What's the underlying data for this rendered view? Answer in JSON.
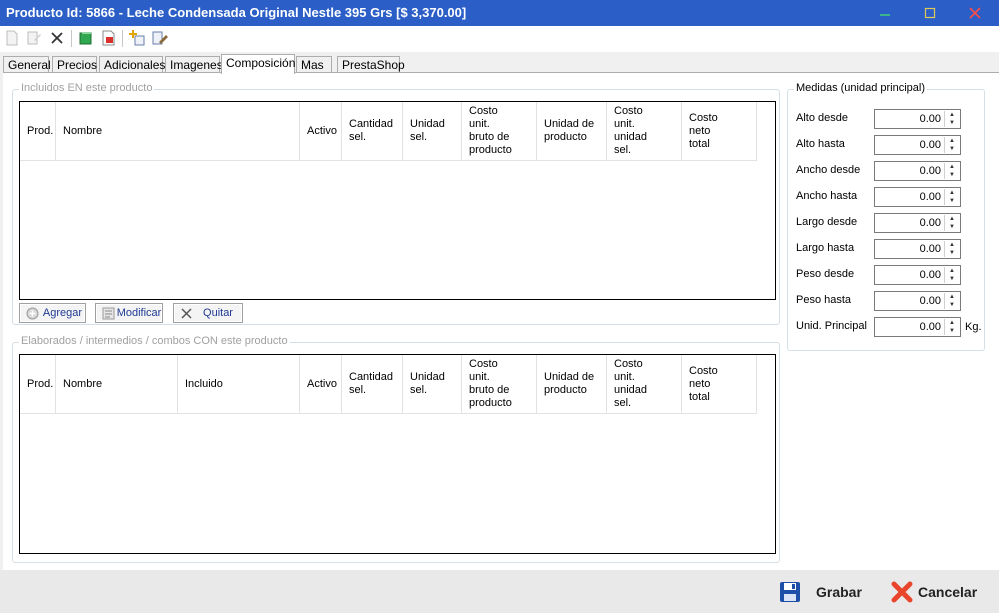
{
  "window": {
    "title": "Producto Id: 5866 - Leche Condensada Original Nestle 395 Grs [$ 3,370.00]",
    "minimize_icon": "minimize-icon",
    "maximize_icon": "maximize-icon",
    "close_icon": "close-icon"
  },
  "toolbar": {
    "icons": [
      "new-document-icon",
      "edit-document-icon",
      "delete-x-icon",
      "green-book-icon",
      "pdf-report-icon",
      "add-item-icon",
      "edit-item-icon"
    ]
  },
  "tabs": [
    {
      "label": "General"
    },
    {
      "label": "Precios"
    },
    {
      "label": "Adicionales"
    },
    {
      "label": "Imagenes"
    },
    {
      "label": "Composición"
    },
    {
      "label": "Mas"
    },
    {
      "label": "PrestaShop"
    }
  ],
  "active_tab": "Composición",
  "incluidos": {
    "title": "Incluidos  EN este producto",
    "columns": [
      "Prod.",
      "Nombre",
      "Activo",
      "Cantidad\nsel.",
      "Unidad\nsel.",
      "Costo\nunit.\nbruto de\nproducto",
      "Unidad de\nproducto",
      "Costo\nunit.\nunidad\nsel.",
      "Costo\nneto\ntotal"
    ],
    "rows": [],
    "buttons": {
      "add": "Agregar",
      "edit": "Modificar",
      "remove": "Quitar"
    }
  },
  "elaborados": {
    "title": "Elaborados / intermedios / combos CON este producto",
    "columns": [
      "Prod.",
      "Nombre",
      "Incluido",
      "Activo",
      "Cantidad\nsel.",
      "Unidad\nsel.",
      "Costo\nunit.\nbruto de\nproducto",
      "Unidad de\nproducto",
      "Costo\nunit.\nunidad\nsel.",
      "Costo\nneto\ntotal"
    ],
    "rows": []
  },
  "medidas": {
    "title": "Medidas (unidad principal)",
    "fields": [
      {
        "label": "Alto desde",
        "value": "0.00"
      },
      {
        "label": "Alto hasta",
        "value": "0.00"
      },
      {
        "label": "Ancho desde",
        "value": "0.00"
      },
      {
        "label": "Ancho hasta",
        "value": "0.00"
      },
      {
        "label": "Largo desde",
        "value": "0.00"
      },
      {
        "label": "Largo hasta",
        "value": "0.00"
      },
      {
        "label": "Peso desde",
        "value": "0.00"
      },
      {
        "label": "Peso hasta",
        "value": "0.00"
      },
      {
        "label": "Unid. Principal",
        "value": "0.00",
        "unit": "Kg."
      }
    ]
  },
  "footer": {
    "save_label": "Grabar",
    "cancel_label": "Cancelar"
  },
  "colors": {
    "titlebar": "#2b5fc7",
    "link_text": "#1f3a93",
    "cancel_red": "#e8452c",
    "save_blue": "#1e4fa8"
  }
}
